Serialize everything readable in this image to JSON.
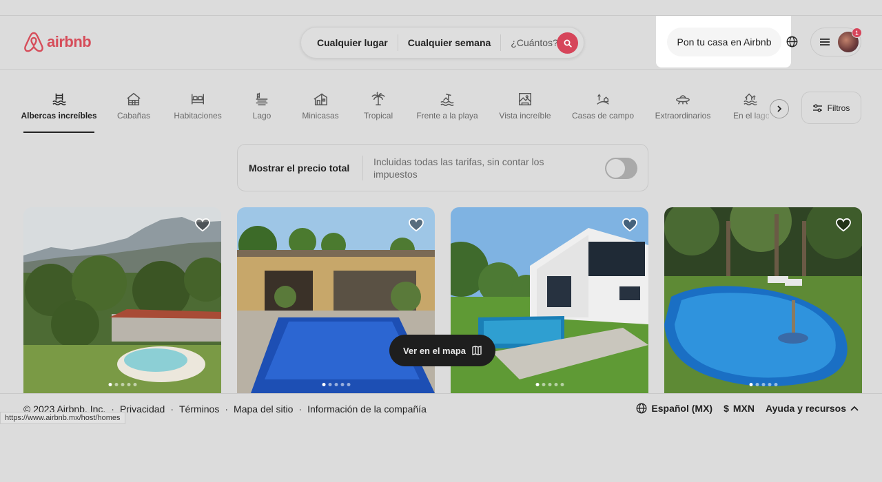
{
  "brand": {
    "name": "airbnb",
    "color": "#d64d5a"
  },
  "search": {
    "where": "Cualquier lugar",
    "when": "Cualquier semana",
    "who": "¿Cuántos?",
    "icon": "search-icon"
  },
  "header": {
    "host_label": "Pon tu casa en Airbnb",
    "notification_count": "1"
  },
  "categories": [
    {
      "label": "Albercas increíbles",
      "icon": "pool-icon",
      "active": true
    },
    {
      "label": "Cabañas",
      "icon": "cabin-icon"
    },
    {
      "label": "Habitaciones",
      "icon": "bed-icon"
    },
    {
      "label": "Lago",
      "icon": "lake-icon"
    },
    {
      "label": "Minicasas",
      "icon": "tiny-home-icon"
    },
    {
      "label": "Tropical",
      "icon": "palm-icon"
    },
    {
      "label": "Frente a la playa",
      "icon": "beach-icon"
    },
    {
      "label": "Vista increíble",
      "icon": "view-icon"
    },
    {
      "label": "Casas de campo",
      "icon": "countryside-icon"
    },
    {
      "label": "Extraordinarios",
      "icon": "ufo-icon"
    },
    {
      "label": "En el lago",
      "icon": "lakefront-icon"
    }
  ],
  "filters_label": "Filtros",
  "price_toggle": {
    "title": "Mostrar el precio total",
    "subtitle": "Incluidas todas las tarifas, sin contar los impuestos",
    "enabled": false
  },
  "listings": [
    {
      "photo": "garden-pool-mountains",
      "dots": 5,
      "active_dot": 1
    },
    {
      "photo": "courtyard-pool",
      "dots": 5,
      "active_dot": 1
    },
    {
      "photo": "modern-house-pool",
      "dots": 5,
      "active_dot": 1
    },
    {
      "photo": "fountain-pool-garden",
      "dots": 5,
      "active_dot": 1
    }
  ],
  "map_button": "Ver en el mapa",
  "footer": {
    "copyright": "© 2023 Airbnb, Inc.",
    "sep": "·",
    "links": [
      "Privacidad",
      "Términos",
      "Mapa del sitio",
      "Información de la compañía"
    ],
    "language": "Español (MX)",
    "currency_symbol": "$",
    "currency": "MXN",
    "help": "Ayuda y recursos"
  },
  "status_url": "https://www.airbnb.mx/host/homes"
}
